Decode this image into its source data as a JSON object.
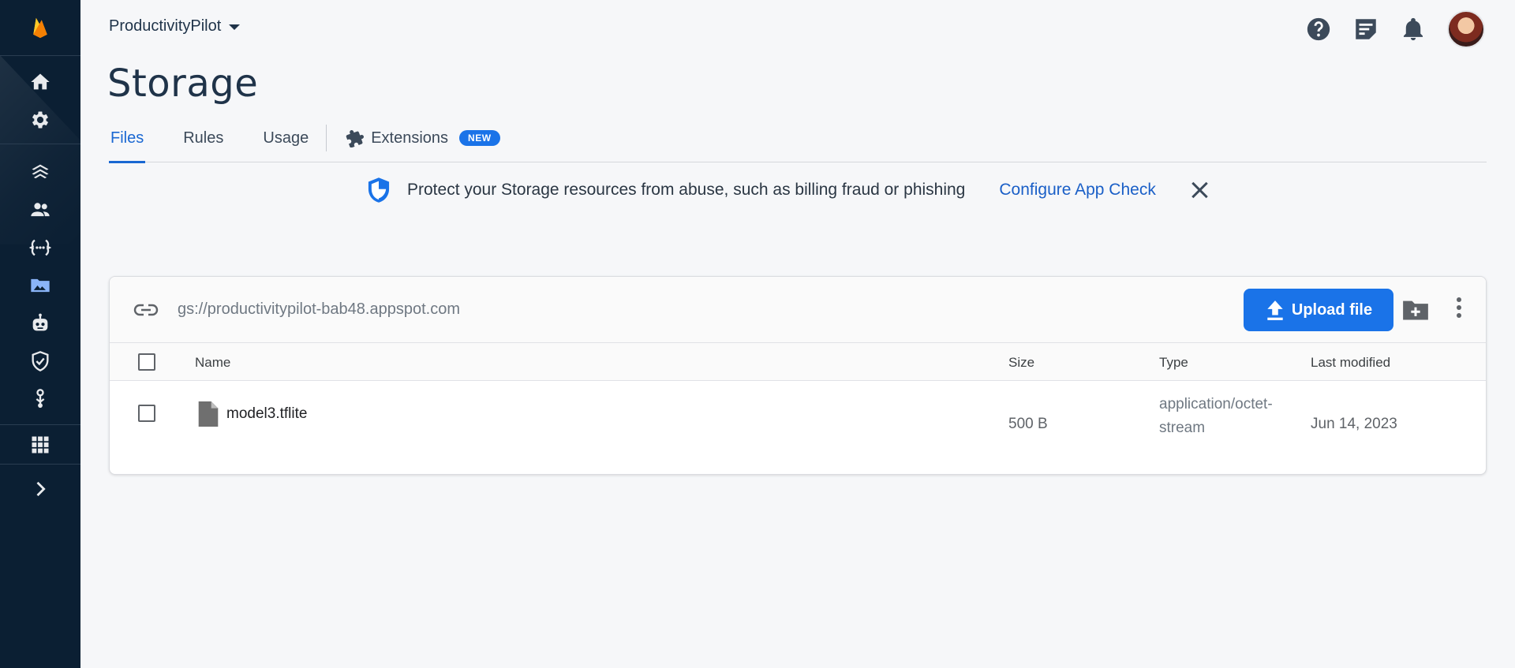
{
  "header": {
    "project_name": "ProductivityPilot",
    "page_title": "Storage"
  },
  "tabs": [
    {
      "label": "Files",
      "active": true
    },
    {
      "label": "Rules",
      "active": false
    },
    {
      "label": "Usage",
      "active": false
    },
    {
      "label": "Extensions",
      "active": false,
      "badge": "NEW"
    }
  ],
  "banner": {
    "icon": "shield-icon",
    "message": "Protect your Storage resources from abuse, such as billing fraud or phishing",
    "action_label": "Configure App Check"
  },
  "storage": {
    "bucket_path": "gs://productivitypilot-bab48.appspot.com",
    "upload_label": "Upload file",
    "columns": {
      "name": "Name",
      "size": "Size",
      "type": "Type",
      "last_modified": "Last modified"
    },
    "files": [
      {
        "name": "model3.tflite",
        "size": "500 B",
        "type": "application/octet-stream",
        "last_modified": "Jun 14, 2023"
      }
    ]
  },
  "rail": {
    "items": [
      "firebase-logo",
      "home-icon",
      "settings-icon",
      "hosting-icon",
      "authentication-icon",
      "functions-icon",
      "storage-icon",
      "ml-icon",
      "app-check-icon",
      "extensions-icon",
      "all-products-icon",
      "expand-icon"
    ],
    "active": "storage-icon"
  },
  "colors": {
    "rail_bg": "#0b1f33",
    "accent": "#1a73e8",
    "page_bg": "#f6f7f9"
  }
}
